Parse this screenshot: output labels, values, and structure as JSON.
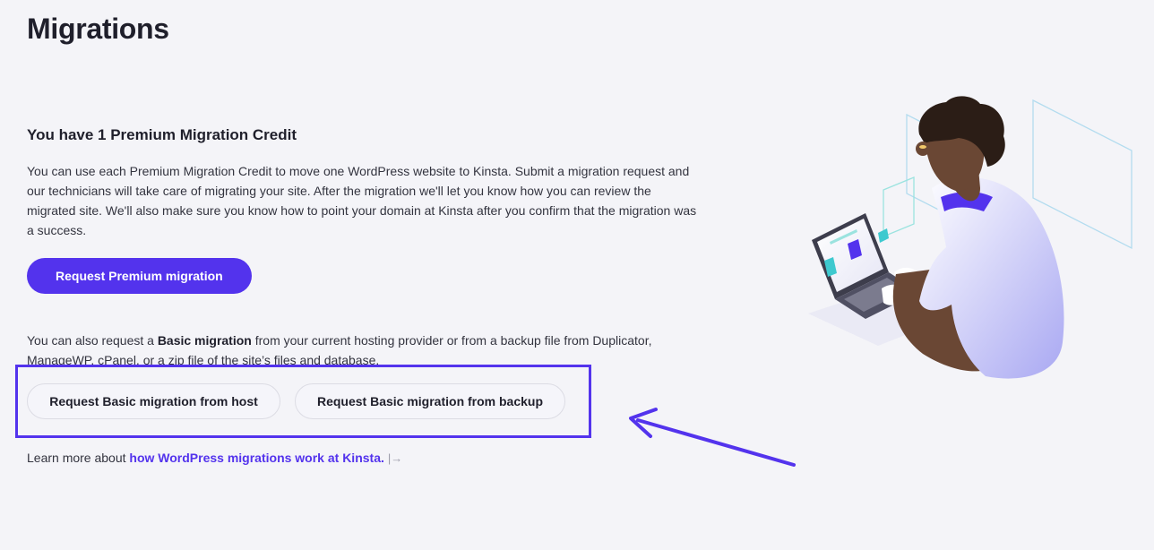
{
  "page": {
    "title": "Migrations"
  },
  "premium": {
    "heading": "You have 1 Premium Migration Credit",
    "description": "You can use each Premium Migration Credit to move one WordPress website to Kinsta. Submit a migration request and our technicians will take care of migrating your site. After the migration we'll let you know how you can review the migrated site. We'll also make sure you know how to point your domain at Kinsta after you confirm that the migration was a success.",
    "button_label": "Request Premium migration"
  },
  "basic": {
    "description_prefix": "You can also request a ",
    "description_bold": "Basic migration",
    "description_suffix": " from your current hosting provider or from a backup file from Duplicator, ManageWP, cPanel, or a zip file of the site’s files and database.",
    "host_button_label": "Request Basic migration from host",
    "backup_button_label": "Request Basic migration from backup"
  },
  "learn_more": {
    "prefix": "Learn more about ",
    "link_text": "how WordPress migrations work at Kinsta.",
    "icon": "external-link-icon",
    "icon_glyph": "|→"
  },
  "colors": {
    "accent": "#5333ed",
    "background": "#f4f4f8",
    "text": "#1f1f2b"
  },
  "illustration": {
    "description_icon": "person-with-laptop-illustration"
  }
}
